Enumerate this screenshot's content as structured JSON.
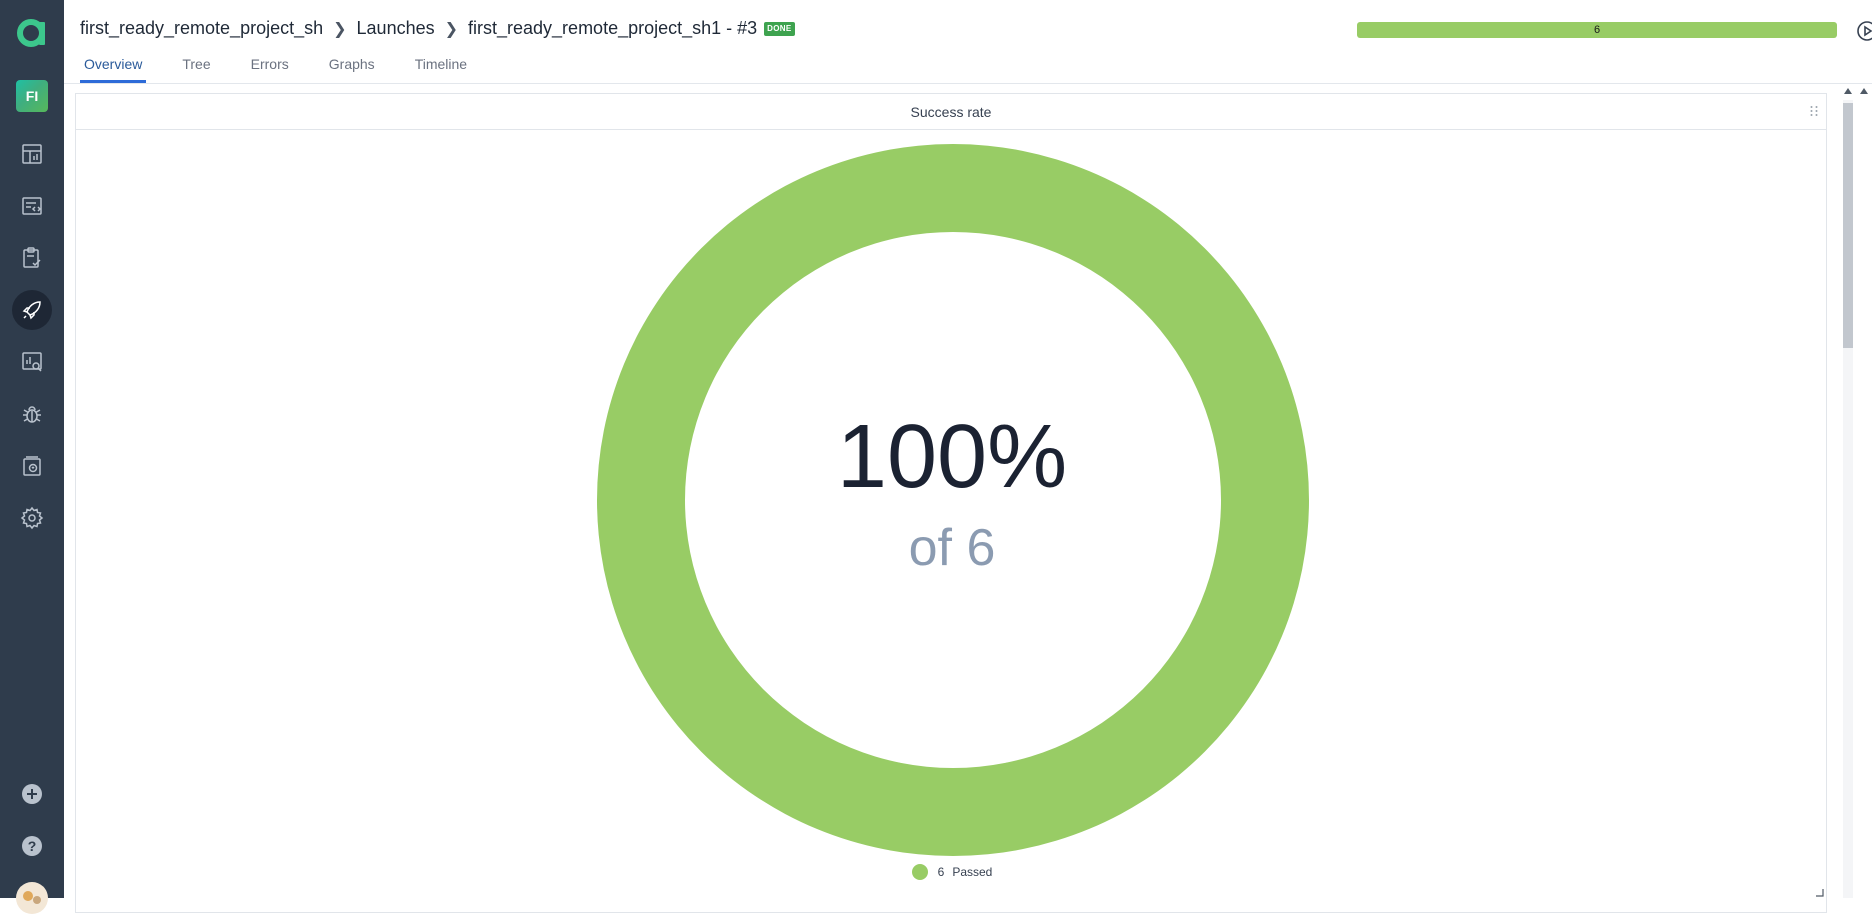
{
  "sidebar": {
    "project_initials": "FI",
    "items": [
      {
        "name": "dashboards-icon"
      },
      {
        "name": "launches-icon"
      },
      {
        "name": "test-plans-icon"
      },
      {
        "name": "rocket-icon",
        "active": true
      },
      {
        "name": "analysis-icon"
      },
      {
        "name": "debug-icon"
      },
      {
        "name": "filters-icon"
      },
      {
        "name": "settings-icon"
      }
    ],
    "bottom_items": [
      {
        "name": "add-icon"
      },
      {
        "name": "help-icon"
      },
      {
        "name": "user-avatar"
      }
    ]
  },
  "header": {
    "breadcrumb": [
      "first_ready_remote_project_sh",
      "Launches",
      "first_ready_remote_project_sh1 - #3"
    ],
    "status_badge": "DONE",
    "progress_label": "6",
    "progress_fraction": 1.0,
    "progress_color": "#98cc65",
    "tabs": [
      "Overview",
      "Tree",
      "Errors",
      "Graphs",
      "Timeline"
    ],
    "active_tab": "Overview"
  },
  "widget": {
    "title": "Success rate",
    "percent": "100%",
    "of_total": "of 6",
    "legend": {
      "count": "6",
      "label": "Passed",
      "color": "#98cc65"
    }
  },
  "chart_data": {
    "type": "pie",
    "variant": "donut",
    "title": "Success rate",
    "categories": [
      "Passed"
    ],
    "values": [
      6
    ],
    "total": 6,
    "center_label": "100%",
    "colors": [
      "#98cc65"
    ],
    "legend": "bottom"
  },
  "colors": {
    "sidebar_bg": "#2f3c4c",
    "accent": "#2d6bd8",
    "passed": "#98cc65",
    "done_badge": "#3ea34f"
  }
}
